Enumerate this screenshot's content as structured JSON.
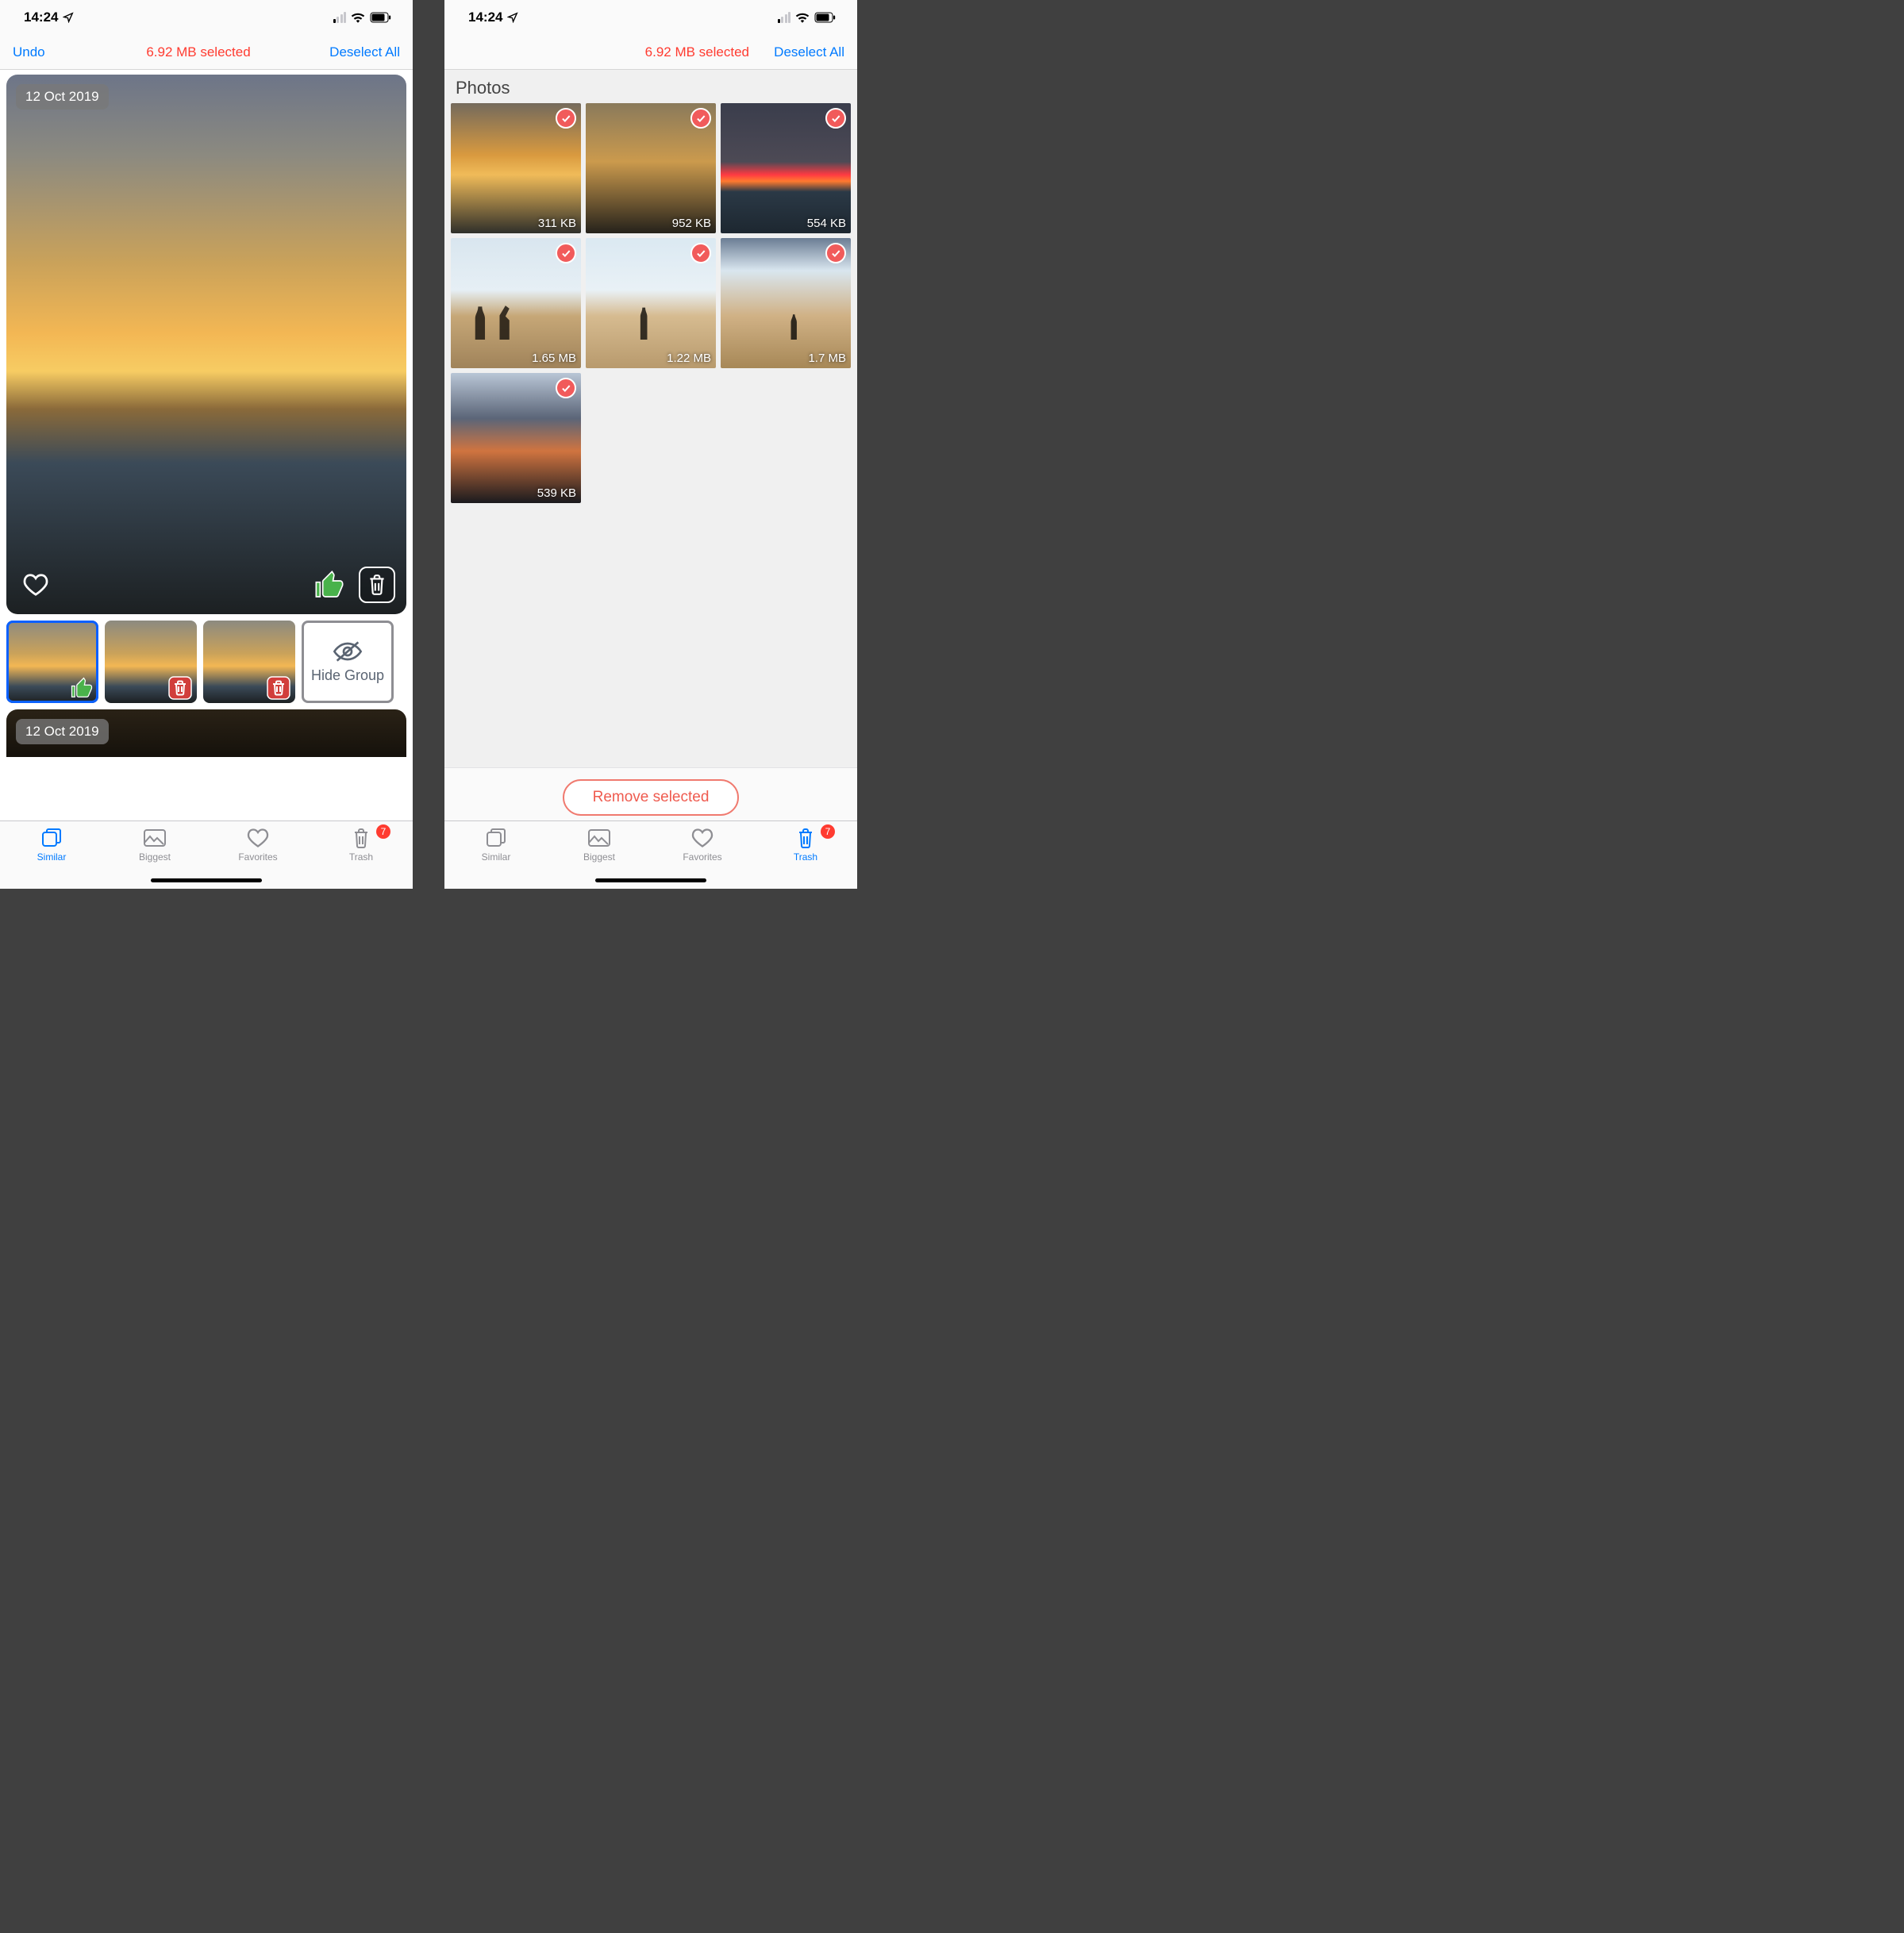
{
  "status": {
    "time": "14:24"
  },
  "left": {
    "nav": {
      "undo": "Undo",
      "selected": "6.92 MB selected",
      "deselect": "Deselect All"
    },
    "group1": {
      "date": "12 Oct 2019",
      "hide": "Hide Group"
    },
    "group2": {
      "date": "12 Oct 2019"
    },
    "tabs": {
      "similar": "Similar",
      "biggest": "Biggest",
      "favorites": "Favorites",
      "trash": "Trash",
      "trash_badge": "7"
    }
  },
  "right": {
    "nav": {
      "selected": "6.92 MB selected",
      "deselect": "Deselect All"
    },
    "section": "Photos",
    "cells": [
      {
        "size": "311 KB"
      },
      {
        "size": "952 KB"
      },
      {
        "size": "554 KB"
      },
      {
        "size": "1.65 MB"
      },
      {
        "size": "1.22 MB"
      },
      {
        "size": "1.7 MB"
      },
      {
        "size": "539 KB"
      }
    ],
    "remove": "Remove selected",
    "tabs": {
      "similar": "Similar",
      "biggest": "Biggest",
      "favorites": "Favorites",
      "trash": "Trash",
      "trash_badge": "7"
    }
  }
}
